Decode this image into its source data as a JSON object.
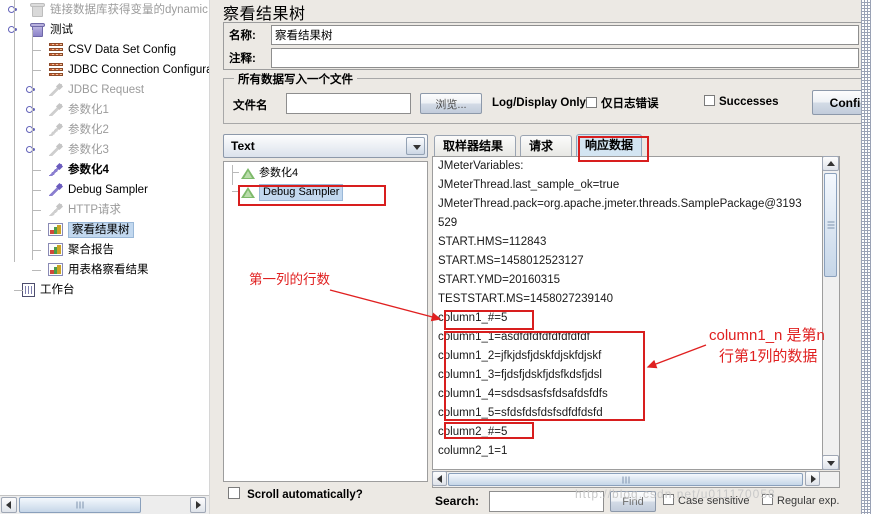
{
  "tree": {
    "nodes": [
      {
        "label": "链接数据库获得变量的dynamic",
        "icon": "thread-group-icon",
        "state": "dim",
        "indent": 30,
        "handle": true,
        "depth": 1
      },
      {
        "label": "测试",
        "icon": "thread-group-icon",
        "state": "normal",
        "indent": 30,
        "handle": true,
        "depth": 1
      },
      {
        "label": "CSV Data Set Config",
        "icon": "config-element-icon",
        "state": "normal",
        "indent": 48,
        "handle": false,
        "depth": 2
      },
      {
        "label": "JDBC Connection Configurat",
        "icon": "config-element-icon",
        "state": "normal",
        "indent": 48,
        "handle": false,
        "depth": 2
      },
      {
        "label": "JDBC Request",
        "icon": "sampler-icon",
        "state": "dim",
        "indent": 48,
        "handle": true,
        "depth": 2
      },
      {
        "label": "参数化1",
        "icon": "sampler-icon",
        "state": "dim",
        "indent": 48,
        "handle": true,
        "depth": 2
      },
      {
        "label": "参数化2",
        "icon": "sampler-icon",
        "state": "dim",
        "indent": 48,
        "handle": true,
        "depth": 2
      },
      {
        "label": "参数化3",
        "icon": "sampler-icon",
        "state": "dim",
        "indent": 48,
        "handle": true,
        "depth": 2
      },
      {
        "label": "参数化4",
        "icon": "sampler-icon",
        "state": "bold",
        "indent": 48,
        "handle": false,
        "depth": 2
      },
      {
        "label": "Debug Sampler",
        "icon": "sampler-icon",
        "state": "normal",
        "indent": 48,
        "handle": false,
        "depth": 2
      },
      {
        "label": "HTTP请求",
        "icon": "sampler-icon",
        "state": "dim",
        "indent": 48,
        "handle": false,
        "depth": 2
      },
      {
        "label": "察看结果树",
        "icon": "listener-icon",
        "state": "selected",
        "indent": 48,
        "handle": false,
        "depth": 2
      },
      {
        "label": "聚合报告",
        "icon": "listener-icon",
        "state": "normal",
        "indent": 48,
        "handle": false,
        "depth": 2
      },
      {
        "label": "用表格察看结果",
        "icon": "listener-icon",
        "state": "normal",
        "indent": 48,
        "handle": false,
        "depth": 2
      },
      {
        "label": "工作台",
        "icon": "workbench-icon",
        "state": "normal",
        "indent": 22,
        "handle": false,
        "depth": 0
      }
    ]
  },
  "header": {
    "title": "察看结果树",
    "name_label": "名称:",
    "name_value": "察看结果树",
    "comment_label": "注释:",
    "comment_value": ""
  },
  "file_group": {
    "title": "所有数据写入一个文件",
    "filename_label": "文件名",
    "filename_value": "",
    "browse_label": "浏览...",
    "log_display_label": "Log/Display Only:",
    "errors_only_label": "仅日志错误",
    "errors_only_checked": false,
    "successes_label": "Successes",
    "successes_checked": false,
    "configure_label": "Configure"
  },
  "sampler_pane": {
    "renderer_selected": "Text",
    "renderer_arrow_icon": "chevron-down-icon",
    "items": [
      {
        "label": "参数化4",
        "selected": false
      },
      {
        "label": "Debug Sampler",
        "selected": true
      }
    ],
    "scroll_auto_label": "Scroll automatically?",
    "scroll_auto_checked": false
  },
  "tabs": [
    {
      "label": "取样器结果",
      "active": false
    },
    {
      "label": "请求",
      "active": false
    },
    {
      "label": "响应数据",
      "active": true
    }
  ],
  "response_lines": [
    "JMeterVariables:",
    "JMeterThread.last_sample_ok=true",
    "JMeterThread.pack=org.apache.jmeter.threads.SamplePackage@3193",
    "529",
    "START.HMS=112843",
    "START.MS=1458012523127",
    "START.YMD=20160315",
    "TESTSTART.MS=1458027239140",
    "column1_#=5",
    "column1_1=asdfdfdfdfdfdfdfdf",
    "column1_2=jfkjdsfjdskfdjskfdjskf",
    "column1_3=fjdsfjdskfjdsfkdsfjdsl",
    "column1_4=sdsdsasfsfdsafdsfdfs",
    "column1_5=sfdsfdsfdsfsdfdfdsfd",
    "column2_#=5",
    "column2_1=1"
  ],
  "search_bar": {
    "label": "Search:",
    "value": "",
    "find_label": "Find",
    "case_sensitive_label": "Case sensitive",
    "case_sensitive_checked": false,
    "regular_exp_label": "Regular exp.",
    "regular_exp_checked": false
  },
  "annotations": [
    {
      "id": "ann-row-count",
      "text": "第一列的行数"
    },
    {
      "id": "ann-col-data-1",
      "text": "column1_n 是第n"
    },
    {
      "id": "ann-col-data-2",
      "text": "行第1列的数据"
    }
  ],
  "watermark": "http://blog.csdn.net/u011170058",
  "colors": {
    "annotation_red": "#e02020",
    "box_red": "#d81e1e",
    "selection_blue": "#c2d8ef",
    "active_tab_blue": "#d3e5f2"
  }
}
